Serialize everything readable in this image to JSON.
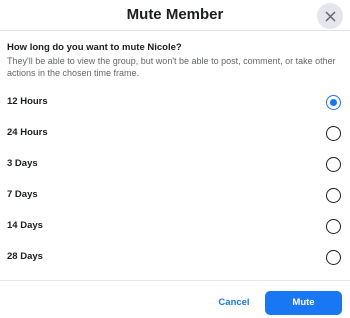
{
  "dialog": {
    "title": "Mute Member",
    "close_icon": "close-icon",
    "question": "How long do you want to mute Nicole?",
    "description": "They'll be able to view the group, but won't be able to post, comment, or take other actions in the chosen time frame.",
    "options": [
      {
        "label": "12 Hours",
        "selected": true
      },
      {
        "label": "24 Hours",
        "selected": false
      },
      {
        "label": "3 Days",
        "selected": false
      },
      {
        "label": "7 Days",
        "selected": false
      },
      {
        "label": "14 Days",
        "selected": false
      },
      {
        "label": "28 Days",
        "selected": false
      }
    ],
    "cancel_label": "Cancel",
    "mute_label": "Mute"
  },
  "colors": {
    "accent": "#1877f2",
    "text": "#1c1e21",
    "secondary_text": "#65676b",
    "close_background": "#e4e6eb"
  }
}
